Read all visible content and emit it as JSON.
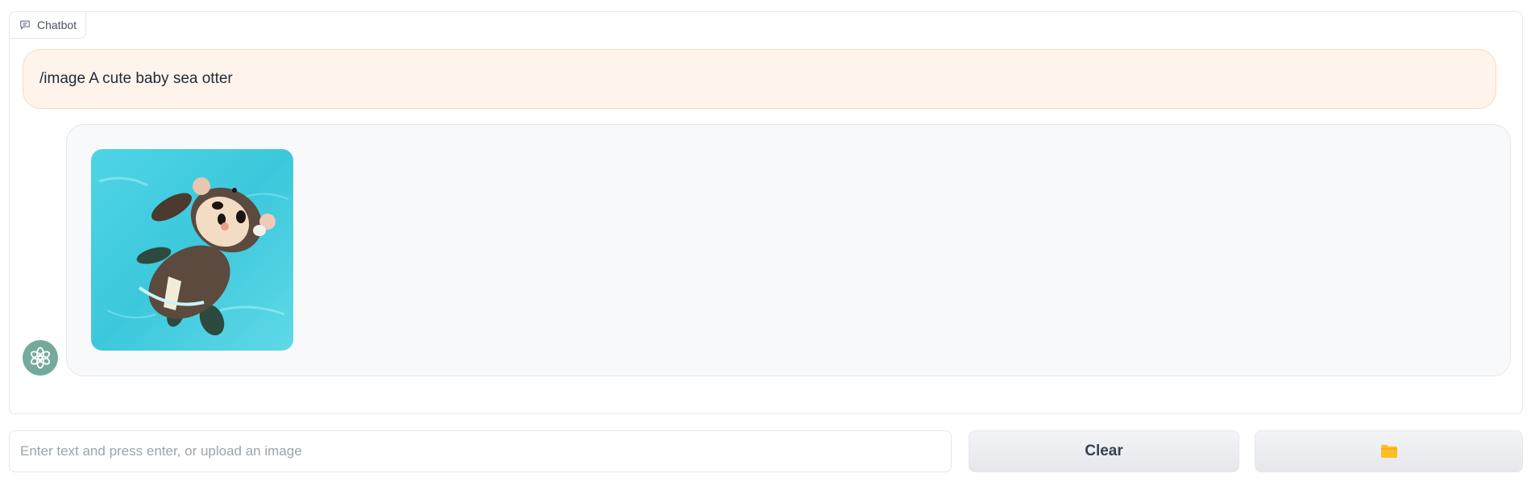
{
  "chatbot": {
    "label": "Chatbot",
    "label_icon": "chat-bubble-icon",
    "messages": [
      {
        "role": "user",
        "text": "/image A cute baby sea otter"
      },
      {
        "role": "bot",
        "content": "image",
        "image_alt": "A cute baby sea otter"
      }
    ],
    "bot_avatar_icon": "openai-logo-icon"
  },
  "input": {
    "placeholder": "Enter text and press enter, or upload an image",
    "value": ""
  },
  "buttons": {
    "clear_label": "Clear",
    "upload_icon": "folder-icon"
  },
  "colors": {
    "user_bubble_bg": "#fff4eb",
    "user_bubble_border": "#fcd9b4",
    "bot_bubble_bg": "#f8f9fb",
    "avatar_bg": "#74aa9c",
    "folder_icon": "#fbbf24"
  }
}
